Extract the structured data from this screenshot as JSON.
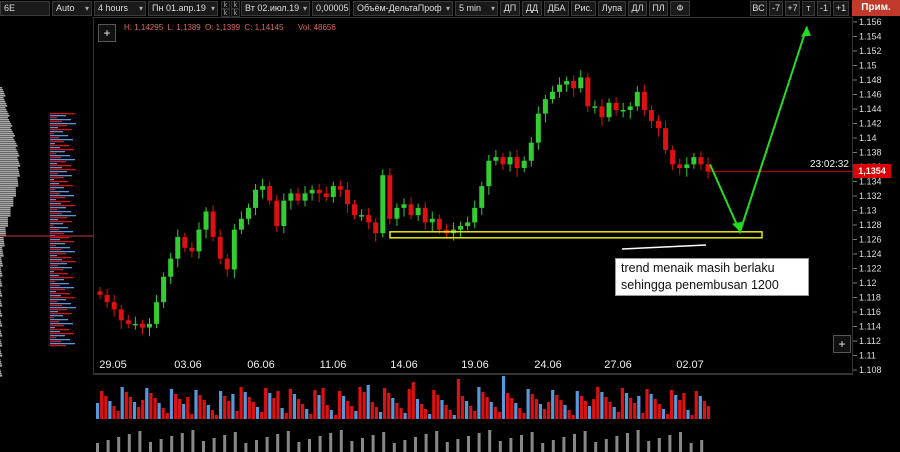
{
  "toolbar": {
    "symbol": "6E",
    "symbol_code": "Auto",
    "timeframe": "4 hours",
    "date_from": "Пн 01.апр.19",
    "date_to": "Вт 02.июл.19",
    "tick_size": "0,00005",
    "indicator": "Объём-ДельтаПроф",
    "profile_period": "5 min",
    "buttons": [
      "ДП",
      "ДД",
      "ДБА",
      "Рис.",
      "Лупа",
      "ДЛ",
      "ПЛ",
      "Ф"
    ],
    "nav_buttons": [
      "ВС",
      "-7",
      "+7",
      "т",
      "-1",
      "+1"
    ],
    "apply_label": "Прим."
  },
  "ohlc": {
    "high": "H: 1,14295",
    "low": "L: 1,1389",
    "open": "O: 1,1399",
    "close": "C: 1,14145",
    "volume": "Vol: 48656"
  },
  "last_price": "1,1354",
  "timer": "23:02:32",
  "annotation": {
    "line1": "trend menaik masih berlaku",
    "line2": "sehingga penembusan 1200"
  },
  "colors": {
    "bull": "#33cc33",
    "bear": "#dd1111",
    "zone": "#e8e800",
    "arrow": "#22dd22",
    "price_line": "#cc0000",
    "vol_buy": "#5599dd",
    "vol_sell": "#dd1111",
    "vol_total": "#888888"
  },
  "icons": {
    "add_top": "plus-icon",
    "add_bottom": "plus-icon"
  },
  "chart_data": {
    "type": "candlestick",
    "x_labels": [
      "29.05",
      "03.06",
      "06.06",
      "11.06",
      "14.06",
      "19.06",
      "24.06",
      "27.06",
      "02.07"
    ],
    "y_ticks": [
      "1.156",
      "1.154",
      "1.152",
      "1.15",
      "1.148",
      "1.146",
      "1.144",
      "1.142",
      "1.14",
      "1.138",
      "1.136",
      "1.134",
      "1.132",
      "1.13",
      "1.128",
      "1.126",
      "1.124",
      "1.122",
      "1.12",
      "1.118",
      "1.116",
      "1.114",
      "1.112",
      "1.11",
      "1.108"
    ],
    "ylim": [
      1.108,
      1.156
    ],
    "closes": [
      1.1185,
      1.1175,
      1.1165,
      1.115,
      1.1145,
      1.1145,
      1.114,
      1.1145,
      1.1175,
      1.121,
      1.1235,
      1.1265,
      1.125,
      1.1245,
      1.1275,
      1.13,
      1.1265,
      1.1235,
      1.122,
      1.1275,
      1.129,
      1.1305,
      1.133,
      1.1335,
      1.1315,
      1.128,
      1.1315,
      1.1325,
      1.1315,
      1.1325,
      1.133,
      1.1325,
      1.132,
      1.1335,
      1.133,
      1.131,
      1.1295,
      1.1295,
      1.1285,
      1.127,
      1.135,
      1.129,
      1.1305,
      1.131,
      1.1295,
      1.1305,
      1.1285,
      1.129,
      1.1275,
      1.127,
      1.1275,
      1.128,
      1.1285,
      1.1305,
      1.1335,
      1.137,
      1.1375,
      1.1365,
      1.1375,
      1.136,
      1.137,
      1.1395,
      1.1435,
      1.1455,
      1.1465,
      1.1475,
      1.148,
      1.147,
      1.1485,
      1.1445,
      1.1445,
      1.143,
      1.145,
      1.144,
      1.144,
      1.1445,
      1.1465,
      1.144,
      1.1425,
      1.1415,
      1.1385,
      1.1365,
      1.136,
      1.1365,
      1.1375,
      1.1365,
      1.1355
    ],
    "zone": {
      "from": 1.1265,
      "to": 1.1272
    },
    "arrow_path": [
      [
        1.1365,
        "02.07"
      ],
      [
        1.1272,
        "target"
      ],
      [
        1.1555,
        "peak"
      ]
    ]
  }
}
